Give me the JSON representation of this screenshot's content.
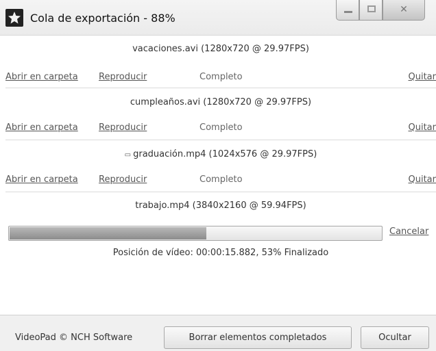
{
  "window": {
    "title": "Cola de exportación - 88%",
    "icon": "videopad-app-icon"
  },
  "items": [
    {
      "filename": "vacaciones.avi (1280x720 @ 29.97FPS)",
      "open_label": "Abrir en carpeta",
      "play_label": "Reproducir",
      "status": "Completo",
      "remove_label": "Quitar"
    },
    {
      "filename": "cumpleaños.avi (1280x720 @ 29.97FPS)",
      "open_label": "Abrir en carpeta",
      "play_label": "Reproducir",
      "status": "Completo",
      "remove_label": "Quitar"
    },
    {
      "filename": "graduación.mp4 (1024x576 @ 29.97FPS)",
      "open_label": "Abrir en carpeta",
      "play_label": "Reproducir",
      "status": "Completo",
      "remove_label": "Quitar"
    }
  ],
  "current": {
    "filename": "trabajo.mp4 (3840x2160 @ 59.94FPS)",
    "progress_fraction": 0.53,
    "cancel_label": "Cancelar",
    "position_text": "Posición de vídeo:  00:00:15.882, 53% Finalizado"
  },
  "footer": {
    "copyright": "VideoPad © NCH Software",
    "clear_label": "Borrar elementos completados",
    "hide_label": "Ocultar"
  },
  "colors": {
    "link": "#555555",
    "progress_fill": "#9a9a9a"
  }
}
